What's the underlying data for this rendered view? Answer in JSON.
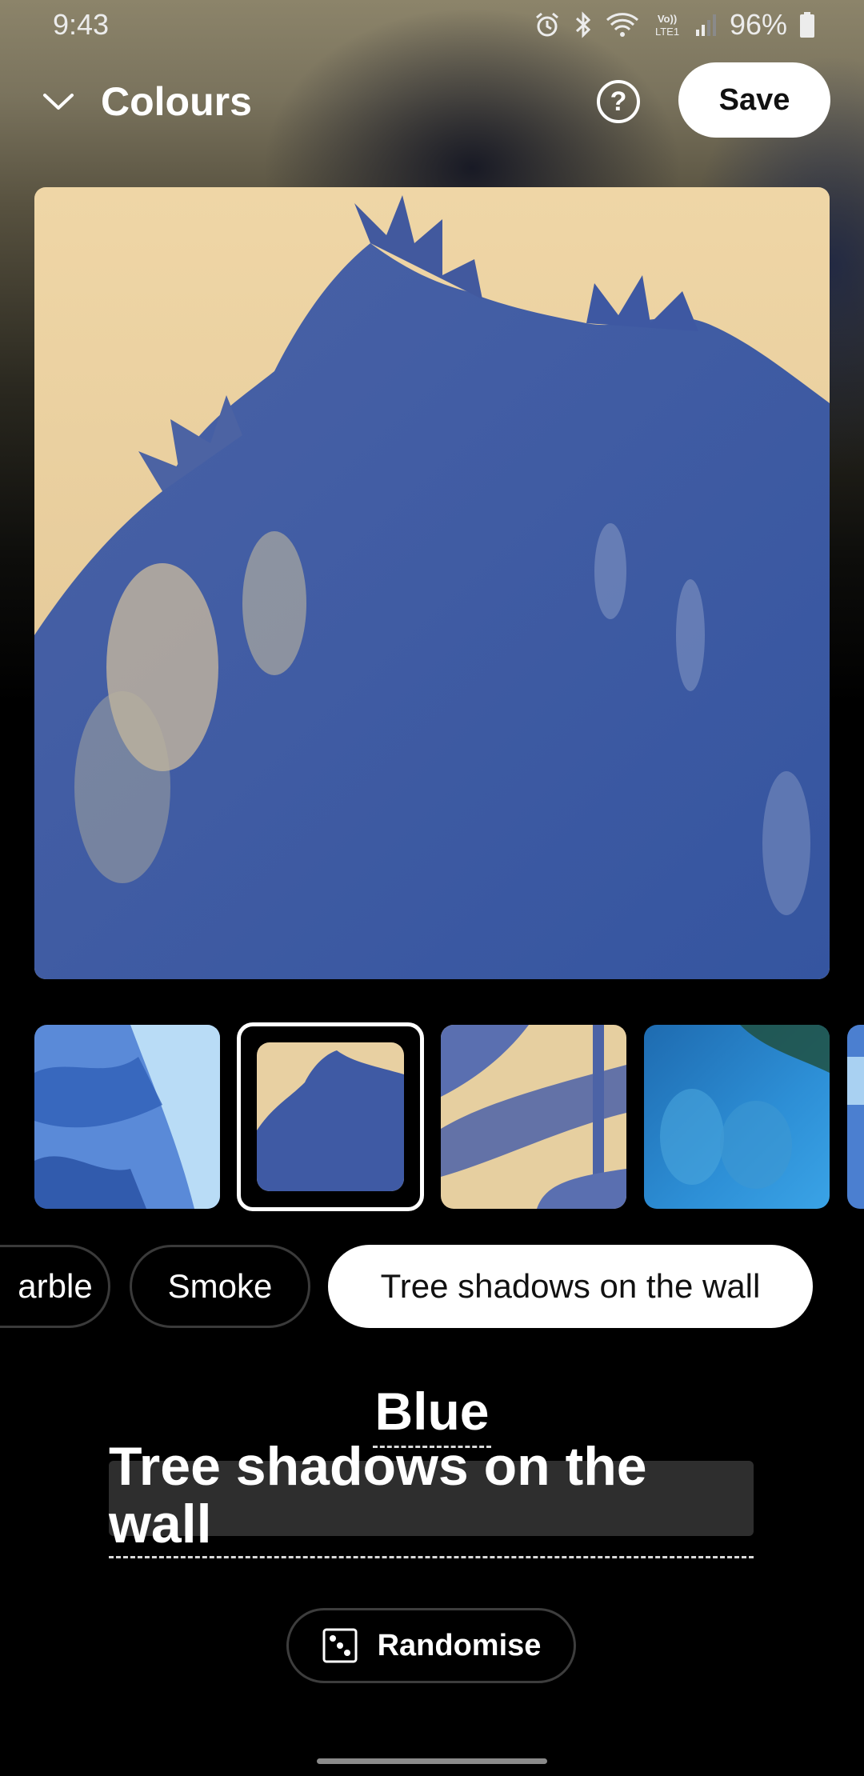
{
  "status_bar": {
    "time": "9:43",
    "battery_percent": "96%",
    "icons": [
      "alarm-icon",
      "bluetooth-icon",
      "wifi-icon",
      "volte-icon",
      "signal-icon",
      "battery-icon"
    ]
  },
  "header": {
    "title": "Colours",
    "help_label": "?",
    "save_label": "Save"
  },
  "thumbnails": [
    {
      "name": "blue-sky-tree",
      "selected": false
    },
    {
      "name": "tree-shadows-on-the-wall",
      "selected": true
    },
    {
      "name": "branch-shadows",
      "selected": false
    },
    {
      "name": "blue-smoke-trees",
      "selected": false
    },
    {
      "name": "partial",
      "selected": false
    }
  ],
  "chips": {
    "items": [
      "arble",
      "Smoke",
      "Tree shadows on the wall"
    ],
    "selected_index": 2
  },
  "selection": {
    "color": "Blue",
    "title": "Tree shadows on the wall"
  },
  "randomise_label": "Randomise",
  "colors": {
    "accent": "#ffffff",
    "background": "#000000",
    "wall_cream": "#e8d1a3",
    "shadow_blue": "#3a5ea6"
  }
}
